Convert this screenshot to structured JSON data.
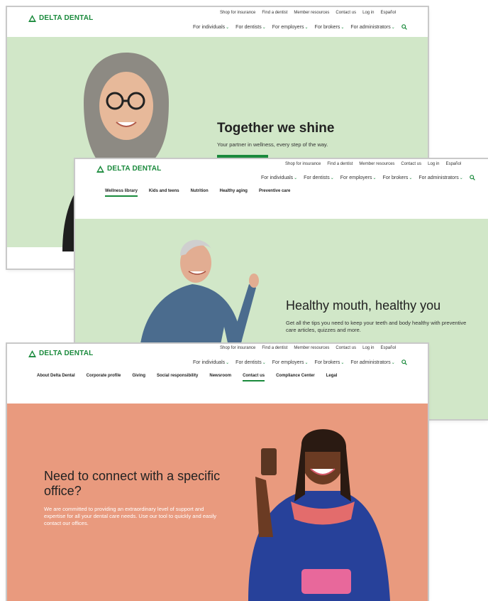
{
  "brand": {
    "logo_text": "DELTA DENTAL",
    "accent": "#1a8a3c"
  },
  "utility_links": [
    "Shop for insurance",
    "Find a dentist",
    "Member resources",
    "Contact us",
    "Log in",
    "Español"
  ],
  "main_nav": [
    "For individuals",
    "For dentists",
    "For employers",
    "For brokers",
    "For administrators"
  ],
  "shot1": {
    "hero_title": "Together we shine",
    "hero_subtitle": "Your partner in wellness, every step of the way.",
    "bg_color": "#d1e7c8"
  },
  "shot2": {
    "subnav": [
      "Wellness library",
      "Kids and teens",
      "Nutrition",
      "Healthy aging",
      "Preventive care"
    ],
    "active_subnav": "Wellness library",
    "hero_title": "Healthy mouth, healthy you",
    "hero_subtitle": "Get all the tips you need to keep your teeth and body healthy with preventive care articles, quizzes and more.",
    "bg_color": "#d1e7c8"
  },
  "shot3": {
    "subnav": [
      "About Delta Dental",
      "Corporate profile",
      "Giving",
      "Social responsibility",
      "Newsroom",
      "Contact us",
      "Compliance Center",
      "Legal"
    ],
    "active_subnav": "Contact us",
    "hero_title": "Need to connect with a specific office?",
    "hero_subtitle": "We are committed to providing an extraordinary level of support and expertise for all your dental care needs. Use our tool to quickly and easily contact our offices.",
    "bg_color": "#e99a7e"
  }
}
